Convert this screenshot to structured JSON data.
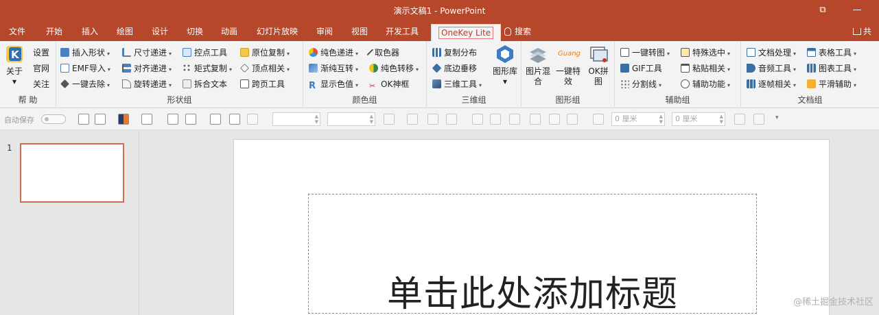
{
  "window": {
    "title": "演示文稿1  -  PowerPoint",
    "restore_glyph": "⧉",
    "minimize_glyph": "—"
  },
  "tabs": [
    "文件",
    "开始",
    "插入",
    "绘图",
    "设计",
    "切换",
    "动画",
    "幻灯片放映",
    "审阅",
    "视图",
    "开发工具"
  ],
  "active_tab": "OneKey Lite",
  "tell_me": "搜索",
  "share": "共",
  "ribbon": {
    "help": {
      "label": "帮 助",
      "about": "关于",
      "items": [
        "设置",
        "官网",
        "关注"
      ]
    },
    "shape": {
      "label": "形状组",
      "col1": [
        "插入形状",
        "EMF导入",
        "一键去除"
      ],
      "col2": [
        "尺寸递进",
        "对齐递进",
        "旋转递进"
      ],
      "col3": [
        "控点工具",
        "矩式复制",
        "拆合文本"
      ],
      "col4": [
        "原位复制",
        "顶点相关",
        "跨页工具"
      ]
    },
    "color": {
      "label": "颜色组",
      "col1": [
        "纯色递进",
        "渐纯互转",
        "显示色值"
      ],
      "col2": [
        "取色器",
        "纯色转移",
        "OK神框"
      ]
    },
    "three_d": {
      "label": "三维组",
      "col1": [
        "复制分布",
        "底边垂移",
        "三维工具"
      ],
      "big": "图形库"
    },
    "graphic": {
      "label": "图形组",
      "big1": "图片混合",
      "big2": "一键特效",
      "big3": "OK拼图",
      "guang": "Guang"
    },
    "assist": {
      "label": "辅助组",
      "col1": [
        "一键转图",
        "GIF工具",
        "分割线"
      ],
      "col2": [
        "特殊选中",
        "粘贴相关",
        "辅助功能"
      ]
    },
    "doc": {
      "label": "文档组",
      "col1": [
        "文档处理",
        "音频工具",
        "逐帧相关"
      ],
      "col2": [
        "表格工具",
        "图表工具",
        "平滑辅助"
      ]
    }
  },
  "qat": {
    "autosave": "自动保存",
    "unit1": "0 厘米",
    "unit2": "0 厘米"
  },
  "slides": {
    "number": "1"
  },
  "slide": {
    "title_placeholder": "单击此处添加标题"
  },
  "watermark": "@稀土掘金技术社区",
  "colors": {
    "accent": "#b7472a",
    "ribbon_bg": "#f3f3f3"
  }
}
